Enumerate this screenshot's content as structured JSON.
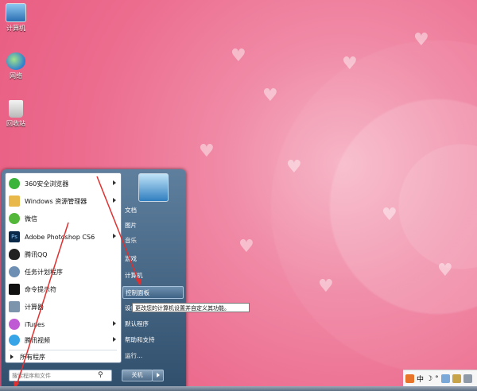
{
  "desktop": {
    "icons": [
      {
        "label": "计算机",
        "icon": "computer-icon"
      },
      {
        "label": "网络",
        "icon": "network-icon"
      },
      {
        "label": "回收站",
        "icon": "recycle-bin-icon"
      }
    ]
  },
  "start_menu": {
    "programs": [
      {
        "label": "360安全浏览器",
        "icon": "360-browser-icon",
        "color": "#3bb43b",
        "has_arrow": true
      },
      {
        "label": "Windows 资源管理器",
        "icon": "explorer-folder-icon",
        "color": "#e8b84a",
        "has_arrow": true
      },
      {
        "label": "微信",
        "icon": "wechat-icon",
        "color": "#53b83a",
        "has_arrow": false
      },
      {
        "label": "Adobe Photoshop CS6",
        "icon": "photoshop-icon",
        "color": "#0b2a4a",
        "has_arrow": true
      },
      {
        "label": "腾讯QQ",
        "icon": "qq-penguin-icon",
        "color": "#222222",
        "has_arrow": false
      },
      {
        "label": "任务计划程序",
        "icon": "task-scheduler-icon",
        "color": "#6d8fb3",
        "has_arrow": false
      },
      {
        "label": "命令提示符",
        "icon": "command-prompt-icon",
        "color": "#111111",
        "has_arrow": false
      },
      {
        "label": "计算器",
        "icon": "calculator-icon",
        "color": "#7c94ac",
        "has_arrow": false
      },
      {
        "label": "iTunes",
        "icon": "itunes-icon",
        "color": "#c05ad4",
        "has_arrow": true
      },
      {
        "label": "腾讯视频",
        "icon": "tencent-video-icon",
        "color": "#36a4e6",
        "has_arrow": true
      }
    ],
    "all_programs": "所有程序",
    "search_placeholder": "搜索程序和文件",
    "right_items": [
      {
        "label": "文档"
      },
      {
        "label": "图片"
      },
      {
        "label": "音乐"
      },
      {
        "label": "游戏"
      },
      {
        "label": "计算机"
      },
      {
        "label": "控制面板"
      },
      {
        "label": "设备和打印机"
      },
      {
        "label": "默认程序"
      },
      {
        "label": "帮助和支持"
      },
      {
        "label": "运行..."
      }
    ],
    "shutdown_label": "关机",
    "tooltip": "更改您的计算机设置并自定义其功能。"
  },
  "tray": {
    "ime": "中",
    "moon": "☽",
    "dot": "°"
  },
  "colors": {
    "annotation_arrow": "#e03030",
    "highlight": "#cfe4f7"
  }
}
